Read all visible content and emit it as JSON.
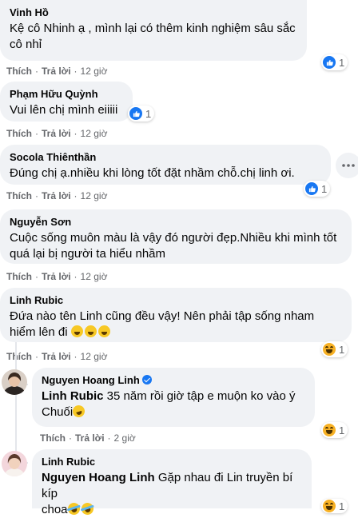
{
  "comments": [
    {
      "author": "Vinh Hồ",
      "text": "Kệ cô Nhinh ạ , mình lại có thêm kinh nghiệm sâu sắc cô nhỉ",
      "like": "Thích",
      "reply": "Trả lời",
      "time": "12 giờ",
      "reaction": {
        "type": "like",
        "count": "1"
      }
    },
    {
      "author": "Phạm Hữu Quỳnh",
      "text": "Vui lên chị mình eiiiii",
      "like": "Thích",
      "reply": "Trả lời",
      "time": "12 giờ",
      "reaction": {
        "type": "like",
        "count": "1"
      }
    },
    {
      "author": "Socola Thiênthần",
      "text": "Đúng chị ạ.nhiều khi lòng tốt đặt nhầm chỗ.chị linh ơi.",
      "like": "Thích",
      "reply": "Trả lời",
      "time": "12 giờ",
      "reaction": {
        "type": "like",
        "count": "1"
      },
      "more_icon": "ellipsis-icon"
    },
    {
      "author": "Nguyễn Sơn",
      "text": "Cuộc sống muôn màu là vậy đó người đẹp.Nhiều khi mình tốt quá lại bị người ta hiểu nhầm",
      "like": "Thích",
      "reply": "Trả lời",
      "time": "12 giờ"
    },
    {
      "author": "Linh Rubic",
      "text": "Đứa nào tên Linh cũng đều vậy! Nên phải tập sống nham hiểm lên đi",
      "like": "Thích",
      "reply": "Trả lời",
      "time": "12 giờ",
      "reaction": {
        "type": "haha",
        "count": "1"
      }
    }
  ],
  "replies": [
    {
      "author": "Nguyen Hoang Linh",
      "verified": true,
      "tag": "Linh Rubic",
      "text_line1": " 35 năm rồi giờ tập e muộn ko vào ý",
      "text_line2": "Chuối",
      "like": "Thích",
      "reply": "Trả lời",
      "time": "2 giờ",
      "reaction": {
        "type": "haha",
        "count": "1"
      }
    },
    {
      "author": "Linh Rubic",
      "tag": "Nguyen Hoang Linh",
      "text_line1": " Gặp nhau đi Lin truyền bí kíp",
      "text_line2": "choa",
      "reaction": {
        "type": "haha",
        "count": "1"
      }
    }
  ],
  "colors": {
    "bubble": "#f0f2f5",
    "meta": "#65676b",
    "like_blue": "#1877f2",
    "haha": "#f7b125"
  }
}
